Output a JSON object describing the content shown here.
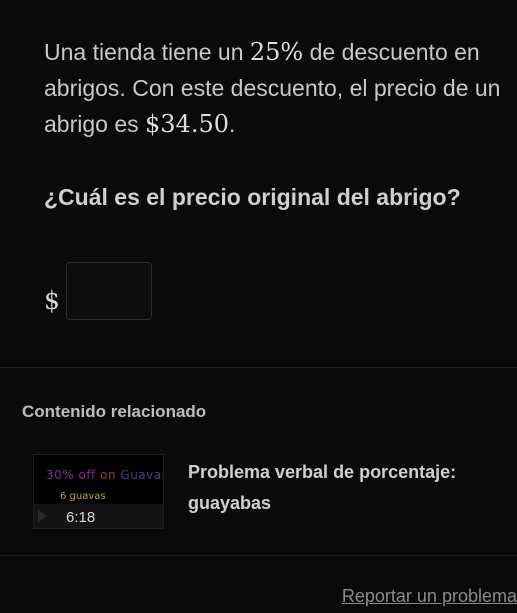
{
  "question": {
    "text1": "Una tienda tiene un ",
    "percent": "25%",
    "text2": " de descuento en abrigos. Con este descuento, el precio de un abrigo es ",
    "price": "$34.50",
    "text3": ".",
    "prompt": "¿Cuál es el precio original del abrigo?"
  },
  "answer": {
    "currency": "$",
    "value": ""
  },
  "related": {
    "heading": "Contenido relacionado",
    "videos": [
      {
        "thumbnail_line1_a": "30% off",
        "thumbnail_line1_b": "on",
        "thumbnail_line1_c": "Guavas",
        "thumbnail_line2": "6 guavas",
        "duration": "6:18",
        "title": "Problema verbal de porcentaje: guayabas"
      }
    ]
  },
  "footer": {
    "report_label": "Reportar un problema"
  },
  "colors": {
    "background": "#0a0a0a",
    "text": "#c8c8c8",
    "link": "#8a8a8a"
  }
}
